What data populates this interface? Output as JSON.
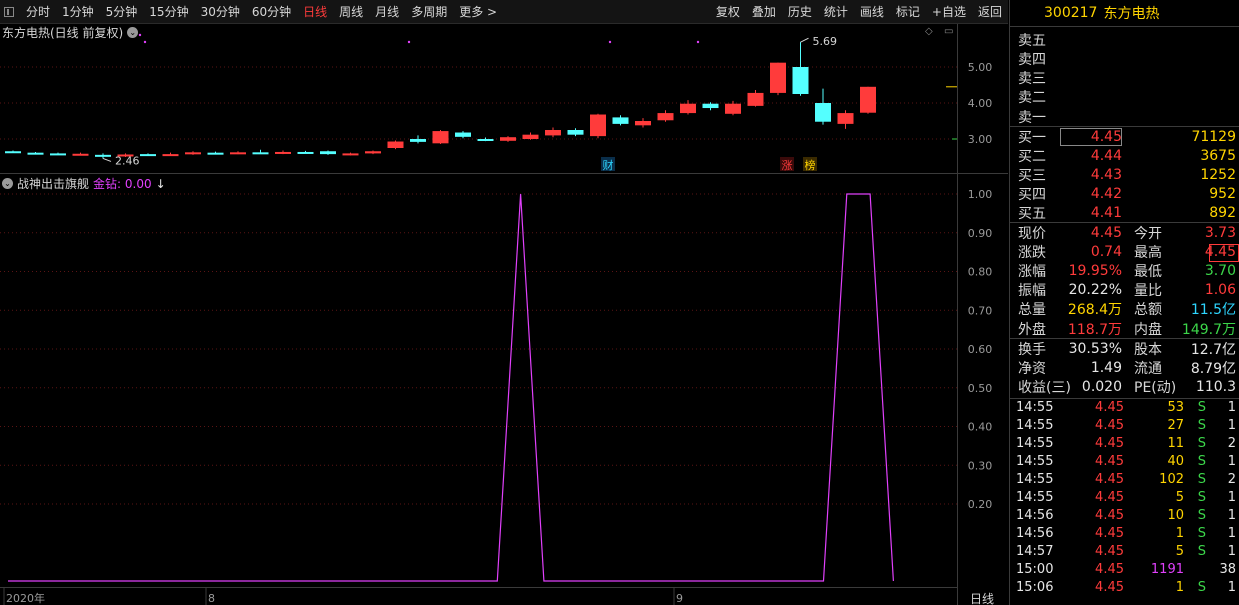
{
  "toolbar": {
    "periods": [
      "分时",
      "1分钟",
      "5分钟",
      "15分钟",
      "30分钟",
      "60分钟",
      "日线",
      "周线",
      "月线",
      "多周期",
      "更多 >"
    ],
    "active_period": "日线",
    "actions": [
      "复权",
      "叠加",
      "历史",
      "统计",
      "画线",
      "标记",
      "+自选",
      "返回"
    ]
  },
  "kline": {
    "title": "东方电热(日线 前复权)",
    "price_axis": [
      "5.00",
      "4.00",
      "3.00"
    ],
    "high_marker": "5.69",
    "low_marker": "2.46",
    "tags": [
      "财",
      "涨",
      "榜"
    ]
  },
  "indicator": {
    "name": "战神出击旗舰",
    "value_label": "金钻: 0.00",
    "arrow": "↓",
    "axis": [
      "1.00",
      "0.90",
      "0.80",
      "0.70",
      "0.60",
      "0.50",
      "0.40",
      "0.30",
      "0.20"
    ]
  },
  "xaxis": {
    "labels": [
      "2020年",
      "8",
      "9"
    ],
    "period_label": "日线"
  },
  "chart_data": {
    "type": "line",
    "series": [
      {
        "values": [
          0,
          0,
          0,
          0,
          0,
          0,
          0,
          0,
          0,
          0,
          0,
          0,
          0,
          0,
          0,
          0,
          0,
          0,
          0,
          0,
          0,
          0,
          1,
          0,
          0,
          0,
          0,
          0,
          0,
          0,
          0,
          0,
          0,
          0,
          0,
          0,
          1,
          1,
          0
        ]
      }
    ],
    "ylim": [
      0,
      1.05
    ]
  },
  "candles": [
    {
      "o": 2.66,
      "c": 2.64,
      "h": 2.68,
      "l": 2.62,
      "up": false
    },
    {
      "o": 2.62,
      "c": 2.6,
      "h": 2.64,
      "l": 2.58,
      "up": false
    },
    {
      "o": 2.6,
      "c": 2.58,
      "h": 2.62,
      "l": 2.56,
      "up": false
    },
    {
      "o": 2.56,
      "c": 2.59,
      "h": 2.62,
      "l": 2.54,
      "up": true
    },
    {
      "o": 2.56,
      "c": 2.52,
      "h": 2.6,
      "l": 2.46,
      "up": false
    },
    {
      "o": 2.52,
      "c": 2.57,
      "h": 2.6,
      "l": 2.5,
      "up": true
    },
    {
      "o": 2.58,
      "c": 2.56,
      "h": 2.6,
      "l": 2.54,
      "up": false
    },
    {
      "o": 2.56,
      "c": 2.58,
      "h": 2.62,
      "l": 2.54,
      "up": true
    },
    {
      "o": 2.58,
      "c": 2.63,
      "h": 2.66,
      "l": 2.56,
      "up": true
    },
    {
      "o": 2.62,
      "c": 2.6,
      "h": 2.65,
      "l": 2.58,
      "up": false
    },
    {
      "o": 2.6,
      "c": 2.63,
      "h": 2.66,
      "l": 2.58,
      "up": true
    },
    {
      "o": 2.63,
      "c": 2.61,
      "h": 2.7,
      "l": 2.59,
      "up": false
    },
    {
      "o": 2.61,
      "c": 2.64,
      "h": 2.68,
      "l": 2.58,
      "up": true
    },
    {
      "o": 2.64,
      "c": 2.62,
      "h": 2.67,
      "l": 2.6,
      "up": false
    },
    {
      "o": 2.66,
      "c": 2.58,
      "h": 2.68,
      "l": 2.56,
      "up": false
    },
    {
      "o": 2.57,
      "c": 2.6,
      "h": 2.62,
      "l": 2.54,
      "up": true
    },
    {
      "o": 2.6,
      "c": 2.66,
      "h": 2.68,
      "l": 2.58,
      "up": true
    },
    {
      "o": 2.75,
      "c": 2.93,
      "h": 2.96,
      "l": 2.72,
      "up": true
    },
    {
      "o": 3.0,
      "c": 2.92,
      "h": 3.1,
      "l": 2.88,
      "up": false
    },
    {
      "o": 2.88,
      "c": 3.22,
      "h": 3.25,
      "l": 2.86,
      "up": true
    },
    {
      "o": 3.18,
      "c": 3.06,
      "h": 3.22,
      "l": 3.02,
      "up": false
    },
    {
      "o": 3.0,
      "c": 2.96,
      "h": 3.04,
      "l": 2.94,
      "up": false
    },
    {
      "o": 2.95,
      "c": 3.05,
      "h": 3.08,
      "l": 2.92,
      "up": true
    },
    {
      "o": 3.0,
      "c": 3.12,
      "h": 3.18,
      "l": 2.98,
      "up": true
    },
    {
      "o": 3.1,
      "c": 3.25,
      "h": 3.32,
      "l": 3.05,
      "up": true
    },
    {
      "o": 3.25,
      "c": 3.12,
      "h": 3.3,
      "l": 3.08,
      "up": false
    },
    {
      "o": 3.08,
      "c": 3.68,
      "h": 3.7,
      "l": 3.02,
      "up": true
    },
    {
      "o": 3.6,
      "c": 3.42,
      "h": 3.66,
      "l": 3.38,
      "up": false
    },
    {
      "o": 3.38,
      "c": 3.5,
      "h": 3.58,
      "l": 3.32,
      "up": true
    },
    {
      "o": 3.52,
      "c": 3.72,
      "h": 3.8,
      "l": 3.48,
      "up": true
    },
    {
      "o": 3.72,
      "c": 3.98,
      "h": 4.08,
      "l": 3.68,
      "up": true
    },
    {
      "o": 3.98,
      "c": 3.86,
      "h": 4.02,
      "l": 3.8,
      "up": false
    },
    {
      "o": 3.7,
      "c": 3.98,
      "h": 4.06,
      "l": 3.66,
      "up": true
    },
    {
      "o": 3.92,
      "c": 4.28,
      "h": 4.36,
      "l": 3.9,
      "up": true
    },
    {
      "o": 4.28,
      "c": 5.12,
      "h": 5.12,
      "l": 4.22,
      "up": true
    },
    {
      "o": 5.0,
      "c": 4.25,
      "h": 5.69,
      "l": 4.2,
      "up": false
    },
    {
      "o": 4.0,
      "c": 3.48,
      "h": 4.4,
      "l": 3.4,
      "up": false
    },
    {
      "o": 3.42,
      "c": 3.72,
      "h": 3.8,
      "l": 3.28,
      "up": true
    },
    {
      "o": 3.73,
      "c": 4.45,
      "h": 4.45,
      "l": 3.7,
      "up": true
    }
  ],
  "quote": {
    "code": "300217",
    "name": "东方电热",
    "ask_labels": [
      "卖五",
      "卖四",
      "卖三",
      "卖二",
      "卖一"
    ],
    "bids": [
      {
        "label": "买一",
        "price": "4.45",
        "vol": "71129"
      },
      {
        "label": "买二",
        "price": "4.44",
        "vol": "3675"
      },
      {
        "label": "买三",
        "price": "4.43",
        "vol": "1252"
      },
      {
        "label": "买四",
        "price": "4.42",
        "vol": "952"
      },
      {
        "label": "买五",
        "price": "4.41",
        "vol": "892"
      }
    ],
    "stats": [
      {
        "l1": "现价",
        "v1": "4.45",
        "c1": "r",
        "l2": "今开",
        "v2": "3.73",
        "c2": "r"
      },
      {
        "l1": "涨跌",
        "v1": "0.74",
        "c1": "r",
        "l2": "最高",
        "v2": "4.45",
        "c2": "r"
      },
      {
        "l1": "涨幅",
        "v1": "19.95%",
        "c1": "r",
        "l2": "最低",
        "v2": "3.70",
        "c2": "g"
      },
      {
        "l1": "振幅",
        "v1": "20.22%",
        "c1": "w",
        "l2": "量比",
        "v2": "1.06",
        "c2": "r"
      },
      {
        "l1": "总量",
        "v1": "268.4万",
        "c1": "y",
        "l2": "总额",
        "v2": "11.5亿",
        "c2": "c"
      },
      {
        "l1": "外盘",
        "v1": "118.7万",
        "c1": "r",
        "l2": "内盘",
        "v2": "149.7万",
        "c2": "g"
      }
    ],
    "stats2": [
      {
        "l1": "换手",
        "v1": "30.53%",
        "l2": "股本",
        "v2": "12.7亿"
      },
      {
        "l1": "净资",
        "v1": "1.49",
        "l2": "流通",
        "v2": "8.79亿"
      },
      {
        "l1": "收益(三)",
        "v1": "0.020",
        "l2": "PE(动)",
        "v2": "110.3"
      }
    ],
    "ticks": [
      {
        "t": "14:55",
        "p": "4.45",
        "v": "53",
        "s": "S",
        "n": "1"
      },
      {
        "t": "14:55",
        "p": "4.45",
        "v": "27",
        "s": "S",
        "n": "1"
      },
      {
        "t": "14:55",
        "p": "4.45",
        "v": "11",
        "s": "S",
        "n": "2"
      },
      {
        "t": "14:55",
        "p": "4.45",
        "v": "40",
        "s": "S",
        "n": "1"
      },
      {
        "t": "14:55",
        "p": "4.45",
        "v": "102",
        "s": "S",
        "n": "2"
      },
      {
        "t": "14:55",
        "p": "4.45",
        "v": "5",
        "s": "S",
        "n": "1"
      },
      {
        "t": "14:56",
        "p": "4.45",
        "v": "10",
        "s": "S",
        "n": "1"
      },
      {
        "t": "14:56",
        "p": "4.45",
        "v": "1",
        "s": "S",
        "n": "1"
      },
      {
        "t": "14:57",
        "p": "4.45",
        "v": "5",
        "s": "S",
        "n": "1"
      },
      {
        "t": "15:00",
        "p": "4.45",
        "v": "1191",
        "s": "",
        "n": "38"
      },
      {
        "t": "15:06",
        "p": "4.45",
        "v": "1",
        "s": "S",
        "n": "1"
      }
    ]
  }
}
